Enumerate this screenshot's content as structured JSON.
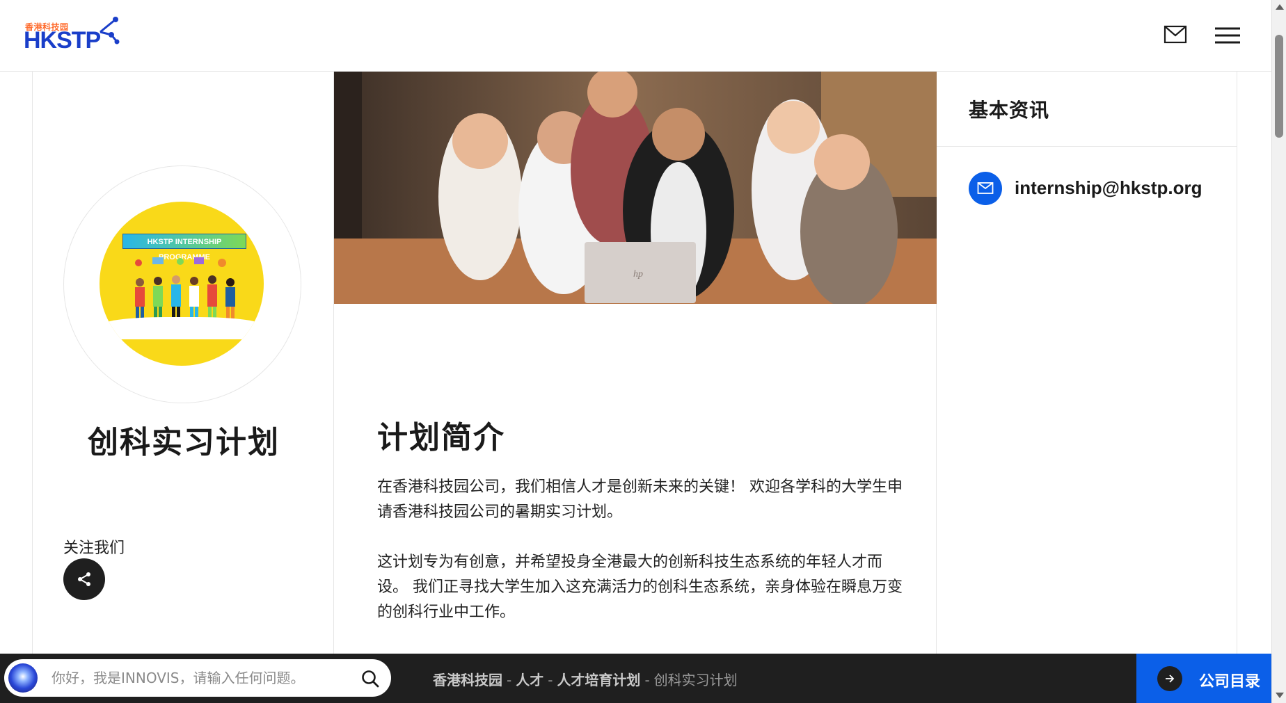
{
  "header": {
    "logo_small_text": "香港科技园",
    "logo_text": "HKSTP",
    "mail_icon": "mail-icon",
    "menu_icon": "hamburger-menu-icon"
  },
  "profile": {
    "logo_banner_text": "HKSTP INTERNSHIP PROGRAMME",
    "title": "创科实习计划",
    "follow_label": "关注我们",
    "share_icon": "share-icon"
  },
  "intro": {
    "heading": "计划简介",
    "paragraphs": [
      "在香港科技园公司，我们相信人才是创新未来的关键！ 欢迎各学科的大学生申请香港科技园公司的暑期实习计划。",
      "这计划专为有创意，并希望投身全港最大的创新科技生态系统的年轻人才而设。 我们正寻找大学生加入这充满活力的创科生态系统，亲身体验在瞬息万变的创科行业中工作。"
    ]
  },
  "info": {
    "title": "基本资讯",
    "email": "internship@hkstp.org",
    "email_icon": "mail-icon"
  },
  "bottom_bar": {
    "ai_placeholder": "你好，我是INNOVIS，请输入任何问题。",
    "search_icon": "search-icon",
    "breadcrumb": [
      "香港科技园",
      "人才",
      "人才培育计划",
      "创科实习计划"
    ],
    "directory_label": "公司目录",
    "directory_icon": "arrow-right-icon"
  },
  "colors": {
    "brand_blue": "#0b5fe8",
    "logo_blue": "#1a3ec9",
    "logo_orange": "#ff6a2b",
    "program_yellow": "#f9d919",
    "bar_dark": "#1f1f1f"
  }
}
